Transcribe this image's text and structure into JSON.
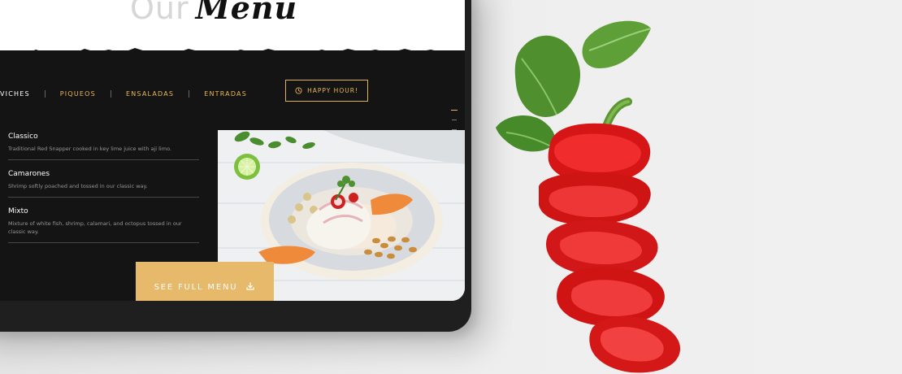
{
  "page": {
    "title_light": "Our",
    "title_script": "Menu"
  },
  "nav": {
    "items": [
      "VICHES",
      "PIQUEOS",
      "ENSALADAS",
      "ENTRADAS"
    ],
    "happy_hour_label": "HAPPY HOUR!"
  },
  "menu": {
    "items": [
      {
        "name": "Classico",
        "description": "Traditional Red Snapper cooked in key lime juice with aji limo."
      },
      {
        "name": "Camarones",
        "description": "Shrimp softly poached and tossed in our classic way."
      },
      {
        "name": "Mixto",
        "description": "Mixture of white fish, shrimp, calamari, and octopus tossed in our classic way."
      }
    ]
  },
  "cta": {
    "label": "SEE FULL MENU"
  },
  "icons": {
    "clock": "clock-icon",
    "download": "download-icon"
  },
  "colors": {
    "accent": "#e7b85a",
    "dark": "#141414",
    "button": "#e7b96b"
  }
}
